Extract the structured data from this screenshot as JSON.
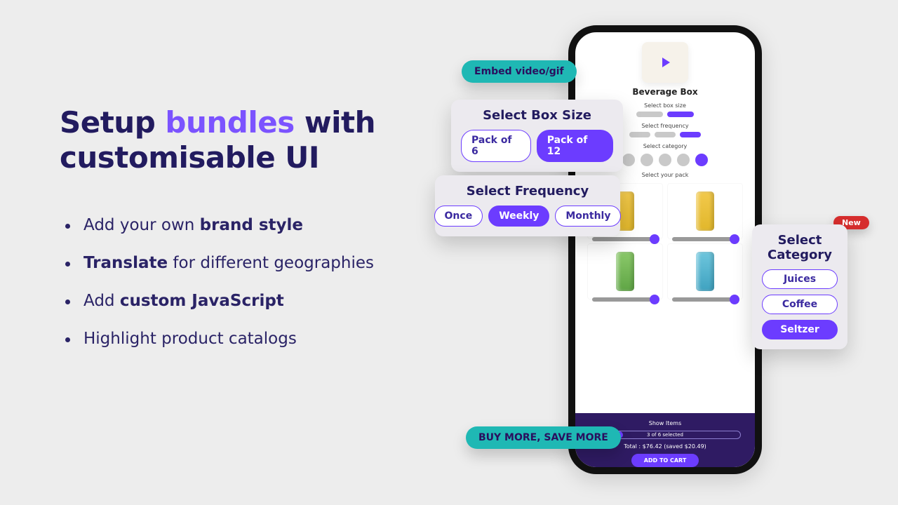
{
  "headline": {
    "t1": "Setup ",
    "hl": "bundles",
    "t2": " with customisable UI"
  },
  "bullets": [
    {
      "pre": "Add your own ",
      "bold": "brand style",
      "post": ""
    },
    {
      "pre": "",
      "bold": "Translate",
      "post": " for different geographies"
    },
    {
      "pre": "Add ",
      "bold": "custom JavaScript",
      "post": ""
    },
    {
      "pre": "Highlight product catalogs",
      "bold": "",
      "post": ""
    }
  ],
  "badges": {
    "embed": "Embed video/gif",
    "buy": "BUY MORE, SAVE MORE",
    "new": "New"
  },
  "card_box": {
    "title": "Select Box Size",
    "opts": [
      "Pack of 6",
      "Pack of 12"
    ],
    "sel": 1
  },
  "card_freq": {
    "title": "Select Frequency",
    "opts": [
      "Once",
      "Weekly",
      "Monthly"
    ],
    "sel": 1
  },
  "card_cat": {
    "title": "Select Category",
    "opts": [
      "Juices",
      "Coffee",
      "Seltzer"
    ],
    "sel": 2
  },
  "phone": {
    "title": "Beverage Box",
    "label_box": "Select box size",
    "label_freq": "Select frequency",
    "label_cat": "Select category",
    "label_pack": "Select your pack",
    "show_items": "Show Items",
    "progress": "3 of 6 selected",
    "total": "Total : $76.42 (saved $20.49)",
    "atc": "ADD TO CART"
  }
}
